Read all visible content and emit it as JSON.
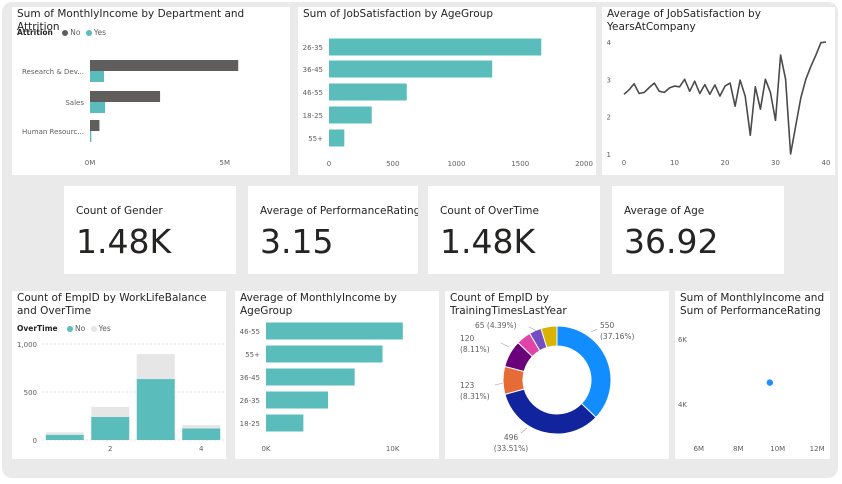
{
  "colors": {
    "teal": "#5bbcbc",
    "dark": "#605e5c",
    "light": "#e6e6e6",
    "line": "#4a4a4a",
    "dot": "#1e90ff"
  },
  "tiles": {
    "dept": {
      "title": "Sum of MonthlyIncome by Department and Attrition",
      "legend_title": "Attrition",
      "legend": [
        "No",
        "Yes"
      ]
    },
    "age_js": {
      "title": "Sum of JobSatisfaction by AgeGroup"
    },
    "years": {
      "title": "Average of JobSatisfaction by YearsAtCompany"
    },
    "wlb": {
      "title": "Count of EmpID by WorkLifeBalance and OverTime",
      "legend_title": "OverTime",
      "legend": [
        "No",
        "Yes"
      ]
    },
    "age_inc": {
      "title": "Average of MonthlyIncome by AgeGroup"
    },
    "donut": {
      "title": "Count of EmpID by TrainingTimesLastYear"
    },
    "scatter": {
      "title": "Sum of MonthlyIncome and Sum of PerformanceRating"
    }
  },
  "cards": [
    {
      "label": "Count of Gender",
      "value": "1.48K"
    },
    {
      "label": "Average of PerformanceRating",
      "value": "3.15"
    },
    {
      "label": "Count of OverTime",
      "value": "1.48K"
    },
    {
      "label": "Average of Age",
      "value": "36.92"
    }
  ],
  "chart_data": [
    {
      "id": "dept",
      "type": "bar",
      "orientation": "horizontal",
      "title": "Sum of MonthlyIncome by Department and Attrition",
      "categories": [
        "Research & Dev...",
        "Sales",
        "Human Resourc..."
      ],
      "series": [
        {
          "name": "No",
          "values": [
            5500000,
            2600000,
            350000
          ]
        },
        {
          "name": "Yes",
          "values": [
            520000,
            560000,
            50000
          ]
        }
      ],
      "xlim": [
        0,
        5900000
      ],
      "xticks": [
        {
          "value": 0,
          "label": "0M"
        },
        {
          "value": 5000000,
          "label": "5M"
        }
      ],
      "legend": "top-left",
      "grid": false
    },
    {
      "id": "age_js",
      "type": "bar",
      "orientation": "horizontal",
      "title": "Sum of JobSatisfaction by AgeGroup",
      "categories": [
        "26-35",
        "36-45",
        "46-55",
        "18-25",
        "55+"
      ],
      "values": [
        1665,
        1280,
        610,
        335,
        120
      ],
      "xlim": [
        0,
        2000
      ],
      "xticks": [
        {
          "value": 0,
          "label": "0"
        },
        {
          "value": 500,
          "label": "500"
        },
        {
          "value": 1000,
          "label": "1000"
        },
        {
          "value": 1500,
          "label": "1500"
        },
        {
          "value": 2000,
          "label": "2000"
        }
      ],
      "grid": false
    },
    {
      "id": "years",
      "type": "line",
      "title": "Average of JobSatisfaction by YearsAtCompany",
      "x": [
        0,
        1,
        2,
        3,
        4,
        5,
        6,
        7,
        8,
        9,
        10,
        11,
        12,
        13,
        14,
        15,
        16,
        17,
        18,
        19,
        20,
        21,
        22,
        23,
        24,
        25,
        26,
        27,
        28,
        29,
        30,
        31,
        32,
        33,
        34,
        35,
        36,
        37,
        38,
        39,
        40
      ],
      "y": [
        2.6,
        2.72,
        2.88,
        2.62,
        2.65,
        2.78,
        2.9,
        2.68,
        2.65,
        2.77,
        2.82,
        2.8,
        3.0,
        2.68,
        2.95,
        2.62,
        2.86,
        2.6,
        2.85,
        2.55,
        2.82,
        2.9,
        2.28,
        2.98,
        2.55,
        1.5,
        2.8,
        2.2,
        3.0,
        2.65,
        1.9,
        3.65,
        3.0,
        1.0,
        1.75,
        2.5,
        3.0,
        3.35,
        3.65,
        3.98,
        4.0
      ],
      "xlim": [
        0,
        40
      ],
      "ylim": [
        1,
        4
      ],
      "xticks": [
        0,
        10,
        20,
        30,
        40
      ],
      "yticks": [
        1,
        2,
        3,
        4
      ],
      "grid": false
    },
    {
      "id": "wlb",
      "type": "bar",
      "stacked": true,
      "title": "Count of EmpID by WorkLifeBalance and OverTime",
      "categories": [
        "1",
        "2",
        "3",
        "4"
      ],
      "series": [
        {
          "name": "No",
          "values": [
            55,
            240,
            635,
            120
          ]
        },
        {
          "name": "Yes",
          "values": [
            25,
            105,
            260,
            35
          ]
        }
      ],
      "ylim": [
        0,
        1000
      ],
      "yticks": [
        {
          "value": 0,
          "label": "0"
        },
        {
          "value": 500,
          "label": "500"
        },
        {
          "value": 1000,
          "label": "1,000"
        }
      ],
      "xticks": [
        {
          "index": 1,
          "label": "2"
        },
        {
          "index": 3,
          "label": "4"
        }
      ],
      "legend": "top-left",
      "grid": true
    },
    {
      "id": "age_inc",
      "type": "bar",
      "orientation": "horizontal",
      "title": "Average of MonthlyIncome by AgeGroup",
      "categories": [
        "46-55",
        "55+",
        "36-45",
        "26-35",
        "18-25"
      ],
      "values": [
        10800,
        9200,
        7000,
        4900,
        2950
      ],
      "xlim": [
        0,
        12000
      ],
      "xticks": [
        {
          "value": 0,
          "label": "0K"
        },
        {
          "value": 10000,
          "label": "10K"
        }
      ],
      "grid": false
    },
    {
      "id": "donut",
      "type": "pie",
      "donut": true,
      "title": "Count of EmpID by TrainingTimesLastYear",
      "slices": [
        {
          "value": 550,
          "label": "550",
          "pct": "(37.16%)",
          "color": "#118dff"
        },
        {
          "value": 496,
          "label": "496",
          "pct": "(33.51%)",
          "color": "#12239e"
        },
        {
          "value": 123,
          "label": "123",
          "pct": "(8.31%)",
          "color": "#e66c37"
        },
        {
          "value": 120,
          "label": "120",
          "pct": "(8.11%)",
          "color": "#6b007b"
        },
        {
          "value": 65,
          "label": "65 (4.39%)",
          "pct": "",
          "color": "#e044a7"
        },
        {
          "value": 54,
          "label": "",
          "pct": "",
          "color": "#744ec2"
        },
        {
          "value": 71,
          "label": "",
          "pct": "",
          "color": "#d9b300"
        }
      ]
    },
    {
      "id": "scatter",
      "type": "scatter",
      "title": "Sum of MonthlyIncome and Sum of PerformanceRating",
      "points": [
        {
          "x": 9600000,
          "y": 4650
        }
      ],
      "xlim": [
        5500000,
        12500000
      ],
      "ylim": [
        3100,
        6300
      ],
      "xticks": [
        {
          "value": 6000000,
          "label": "6M"
        },
        {
          "value": 8000000,
          "label": "8M"
        },
        {
          "value": 10000000,
          "label": "10M"
        },
        {
          "value": 12000000,
          "label": "12M"
        }
      ],
      "yticks": [
        {
          "value": 4000,
          "label": "4K"
        },
        {
          "value": 6000,
          "label": "6K"
        }
      ],
      "grid": false
    }
  ]
}
